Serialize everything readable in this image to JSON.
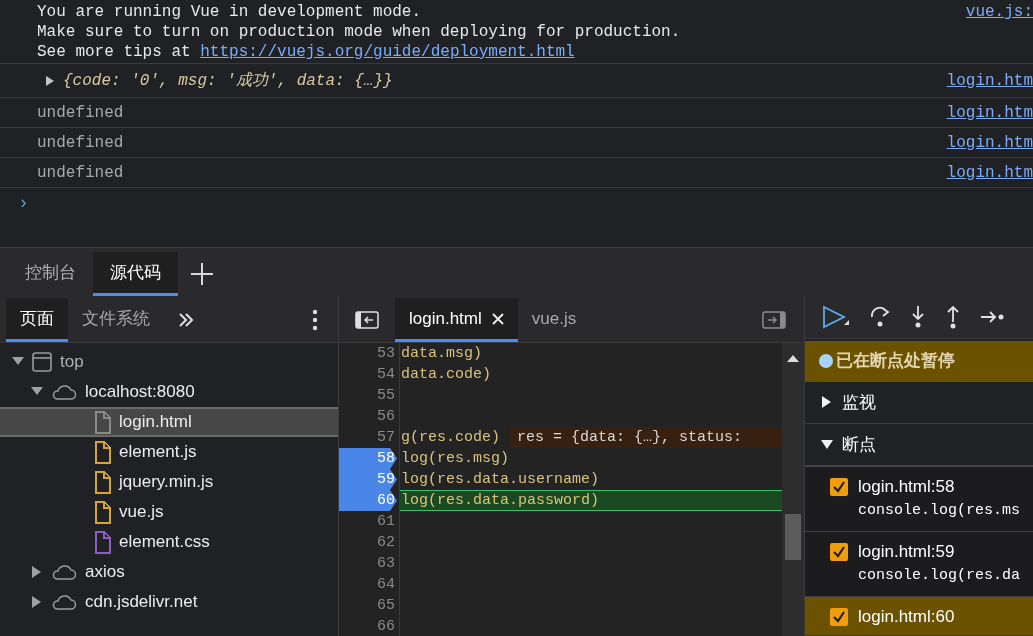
{
  "console": {
    "messages": [
      {
        "kind": "log",
        "lines": [
          {
            "text": "You are running Vue in development mode."
          },
          {
            "text": "Make sure to turn on production mode when deploying for production."
          },
          {
            "text": "See more tips at ",
            "link": "https://vuejs.org/guide/deployment.html"
          }
        ],
        "source": "vue.js:"
      },
      {
        "kind": "object",
        "expanded": false,
        "text": "{code: '0', msg: '成功', data: {…}}",
        "source": "login.htm"
      },
      {
        "kind": "plain",
        "text": "undefined",
        "source": "login.htm"
      },
      {
        "kind": "plain",
        "text": "undefined",
        "source": "login.htm"
      },
      {
        "kind": "plain",
        "text": "undefined",
        "source": "login.htm"
      }
    ],
    "prompt": "›"
  },
  "panel_tabs": [
    {
      "label": "控制台",
      "selected": false
    },
    {
      "label": "源代码",
      "selected": true
    }
  ],
  "navigator": {
    "tabs": [
      {
        "label": "页面",
        "selected": true
      },
      {
        "label": "文件系统",
        "selected": false
      }
    ],
    "tree": [
      {
        "label": "top",
        "kind": "frame",
        "expanded": true,
        "selected": false,
        "children": [
          {
            "label": "localhost:8080",
            "kind": "domain",
            "expanded": true,
            "selected": false,
            "children": [
              {
                "label": "login.html",
                "kind": "file",
                "color": "#8a8a8a",
                "selected": true
              },
              {
                "label": "element.js",
                "kind": "file",
                "color": "#d4a72c",
                "selected": false
              },
              {
                "label": "jquery.min.js",
                "kind": "file",
                "color": "#d4a72c",
                "selected": false
              },
              {
                "label": "vue.js",
                "kind": "file",
                "color": "#d4a72c",
                "selected": false
              },
              {
                "label": "element.css",
                "kind": "file",
                "color": "#8e5cc4",
                "selected": false
              }
            ]
          },
          {
            "label": "axios",
            "kind": "domain",
            "expanded": false,
            "selected": false
          },
          {
            "label": "cdn.jsdelivr.net",
            "kind": "domain",
            "expanded": false,
            "selected": false
          }
        ]
      }
    ]
  },
  "editor": {
    "tabs": [
      {
        "label": "login.html",
        "selected": true,
        "closable": true
      },
      {
        "label": "vue.js",
        "selected": false,
        "closable": false
      }
    ],
    "lines": [
      {
        "number": "53",
        "text": "data.msg)",
        "breakpoint": false,
        "current": false
      },
      {
        "number": "54",
        "text": "data.code)",
        "breakpoint": false,
        "current": false
      },
      {
        "number": "55",
        "breakpoint": false,
        "current": false
      },
      {
        "number": "56",
        "breakpoint": false,
        "current": false
      },
      {
        "number": "57",
        "text": "g(res.code)",
        "inline_value": "res = {data: {…}, status:",
        "breakpoint": false,
        "current": false
      },
      {
        "number": "58",
        "text": "log(res.msg)",
        "breakpoint": true,
        "current": false
      },
      {
        "number": "59",
        "text": "log(res.data.username)",
        "breakpoint": true,
        "current": false
      },
      {
        "number": "60",
        "text": "log(res.data.password)",
        "breakpoint": true,
        "current": true
      },
      {
        "number": "61",
        "breakpoint": false,
        "current": false
      },
      {
        "number": "62",
        "breakpoint": false,
        "current": false
      },
      {
        "number": "63",
        "breakpoint": false,
        "current": false
      },
      {
        "number": "64",
        "breakpoint": false,
        "current": false
      },
      {
        "number": "65",
        "breakpoint": false,
        "current": false
      },
      {
        "number": "66",
        "breakpoint": false,
        "current": false
      }
    ]
  },
  "debugger": {
    "status": "已在断点处暂停",
    "sections": [
      {
        "title": "监视",
        "expanded": false
      },
      {
        "title": "断点",
        "expanded": true
      }
    ],
    "breakpoints": [
      {
        "location": "login.html:58",
        "code": "console.log(res.ms",
        "checked": true,
        "selected": false
      },
      {
        "location": "login.html:59",
        "code": "console.log(res.da",
        "checked": true,
        "selected": false
      },
      {
        "location": "login.html:60",
        "checked": true,
        "selected": true
      }
    ]
  }
}
